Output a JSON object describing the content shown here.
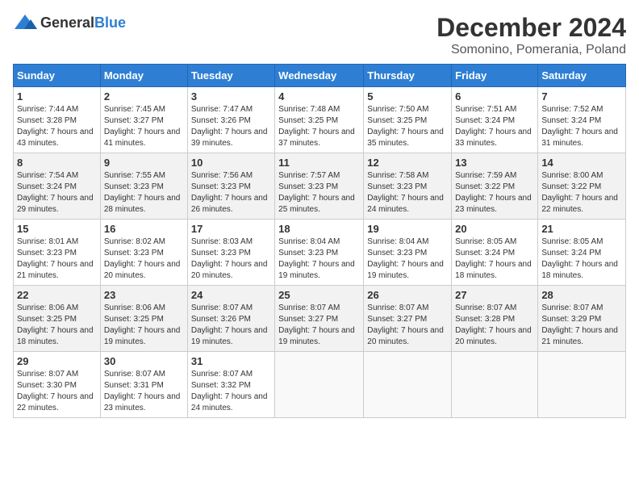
{
  "header": {
    "logo_general": "General",
    "logo_blue": "Blue",
    "title": "December 2024",
    "subtitle": "Somonino, Pomerania, Poland"
  },
  "calendar": {
    "days_of_week": [
      "Sunday",
      "Monday",
      "Tuesday",
      "Wednesday",
      "Thursday",
      "Friday",
      "Saturday"
    ],
    "weeks": [
      [
        {
          "day": "1",
          "sunrise": "7:44 AM",
          "sunset": "3:28 PM",
          "daylight": "7 hours and 43 minutes."
        },
        {
          "day": "2",
          "sunrise": "7:45 AM",
          "sunset": "3:27 PM",
          "daylight": "7 hours and 41 minutes."
        },
        {
          "day": "3",
          "sunrise": "7:47 AM",
          "sunset": "3:26 PM",
          "daylight": "7 hours and 39 minutes."
        },
        {
          "day": "4",
          "sunrise": "7:48 AM",
          "sunset": "3:25 PM",
          "daylight": "7 hours and 37 minutes."
        },
        {
          "day": "5",
          "sunrise": "7:50 AM",
          "sunset": "3:25 PM",
          "daylight": "7 hours and 35 minutes."
        },
        {
          "day": "6",
          "sunrise": "7:51 AM",
          "sunset": "3:24 PM",
          "daylight": "7 hours and 33 minutes."
        },
        {
          "day": "7",
          "sunrise": "7:52 AM",
          "sunset": "3:24 PM",
          "daylight": "7 hours and 31 minutes."
        }
      ],
      [
        {
          "day": "8",
          "sunrise": "7:54 AM",
          "sunset": "3:24 PM",
          "daylight": "7 hours and 29 minutes."
        },
        {
          "day": "9",
          "sunrise": "7:55 AM",
          "sunset": "3:23 PM",
          "daylight": "7 hours and 28 minutes."
        },
        {
          "day": "10",
          "sunrise": "7:56 AM",
          "sunset": "3:23 PM",
          "daylight": "7 hours and 26 minutes."
        },
        {
          "day": "11",
          "sunrise": "7:57 AM",
          "sunset": "3:23 PM",
          "daylight": "7 hours and 25 minutes."
        },
        {
          "day": "12",
          "sunrise": "7:58 AM",
          "sunset": "3:23 PM",
          "daylight": "7 hours and 24 minutes."
        },
        {
          "day": "13",
          "sunrise": "7:59 AM",
          "sunset": "3:22 PM",
          "daylight": "7 hours and 23 minutes."
        },
        {
          "day": "14",
          "sunrise": "8:00 AM",
          "sunset": "3:22 PM",
          "daylight": "7 hours and 22 minutes."
        }
      ],
      [
        {
          "day": "15",
          "sunrise": "8:01 AM",
          "sunset": "3:23 PM",
          "daylight": "7 hours and 21 minutes."
        },
        {
          "day": "16",
          "sunrise": "8:02 AM",
          "sunset": "3:23 PM",
          "daylight": "7 hours and 20 minutes."
        },
        {
          "day": "17",
          "sunrise": "8:03 AM",
          "sunset": "3:23 PM",
          "daylight": "7 hours and 20 minutes."
        },
        {
          "day": "18",
          "sunrise": "8:04 AM",
          "sunset": "3:23 PM",
          "daylight": "7 hours and 19 minutes."
        },
        {
          "day": "19",
          "sunrise": "8:04 AM",
          "sunset": "3:23 PM",
          "daylight": "7 hours and 19 minutes."
        },
        {
          "day": "20",
          "sunrise": "8:05 AM",
          "sunset": "3:24 PM",
          "daylight": "7 hours and 18 minutes."
        },
        {
          "day": "21",
          "sunrise": "8:05 AM",
          "sunset": "3:24 PM",
          "daylight": "7 hours and 18 minutes."
        }
      ],
      [
        {
          "day": "22",
          "sunrise": "8:06 AM",
          "sunset": "3:25 PM",
          "daylight": "7 hours and 18 minutes."
        },
        {
          "day": "23",
          "sunrise": "8:06 AM",
          "sunset": "3:25 PM",
          "daylight": "7 hours and 19 minutes."
        },
        {
          "day": "24",
          "sunrise": "8:07 AM",
          "sunset": "3:26 PM",
          "daylight": "7 hours and 19 minutes."
        },
        {
          "day": "25",
          "sunrise": "8:07 AM",
          "sunset": "3:27 PM",
          "daylight": "7 hours and 19 minutes."
        },
        {
          "day": "26",
          "sunrise": "8:07 AM",
          "sunset": "3:27 PM",
          "daylight": "7 hours and 20 minutes."
        },
        {
          "day": "27",
          "sunrise": "8:07 AM",
          "sunset": "3:28 PM",
          "daylight": "7 hours and 20 minutes."
        },
        {
          "day": "28",
          "sunrise": "8:07 AM",
          "sunset": "3:29 PM",
          "daylight": "7 hours and 21 minutes."
        }
      ],
      [
        {
          "day": "29",
          "sunrise": "8:07 AM",
          "sunset": "3:30 PM",
          "daylight": "7 hours and 22 minutes."
        },
        {
          "day": "30",
          "sunrise": "8:07 AM",
          "sunset": "3:31 PM",
          "daylight": "7 hours and 23 minutes."
        },
        {
          "day": "31",
          "sunrise": "8:07 AM",
          "sunset": "3:32 PM",
          "daylight": "7 hours and 24 minutes."
        },
        null,
        null,
        null,
        null
      ]
    ]
  }
}
